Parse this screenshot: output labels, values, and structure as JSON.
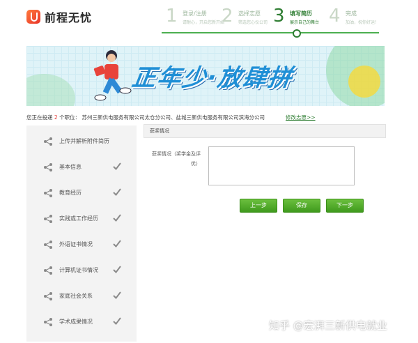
{
  "header": {
    "logo_text": "前程无忧"
  },
  "steps": [
    {
      "num": "1",
      "title": "登录/注册",
      "sub": "请耐心，开启您新开始"
    },
    {
      "num": "2",
      "title": "选择志愿",
      "sub": "筛选您心仪公司"
    },
    {
      "num": "3",
      "title": "填写简历",
      "sub": "展示自己的舞台"
    },
    {
      "num": "4",
      "title": "完成",
      "sub": "加油，祝你好运！"
    }
  ],
  "banner": {
    "slogan": "正年少·放肆拼"
  },
  "notice": {
    "prefix": "您正在投递",
    "count": "2",
    "suffix": "个职位：",
    "companies": "苏州三新供电服务有限公司太仓分公司、盐城三新供电服务有限公司滨海分公司",
    "modify_link": "修改志愿>>"
  },
  "sidebar": {
    "items": [
      {
        "label": "上传并解析附件简历",
        "done": false
      },
      {
        "label": "基本信息",
        "done": true
      },
      {
        "label": "教育经历",
        "done": true
      },
      {
        "label": "实践或工作经历",
        "done": true
      },
      {
        "label": "外语证书情况",
        "done": true
      },
      {
        "label": "计算机证书情况",
        "done": true
      },
      {
        "label": "家庭社会关系",
        "done": true
      },
      {
        "label": "学术成果情况",
        "done": true
      }
    ]
  },
  "main": {
    "section_title": "获奖情况",
    "field_label": "获奖情况（奖学金及评优）",
    "textarea_value": "",
    "buttons": {
      "prev": "上一步",
      "save": "保存",
      "next": "下一步"
    }
  },
  "watermark": "知乎 @宏湃三新供电就业",
  "colors": {
    "accent_green": "#4caf50",
    "button_green": "#3f9a1d",
    "count_red": "#e53935",
    "banner_blue": "#1f8fd6"
  }
}
